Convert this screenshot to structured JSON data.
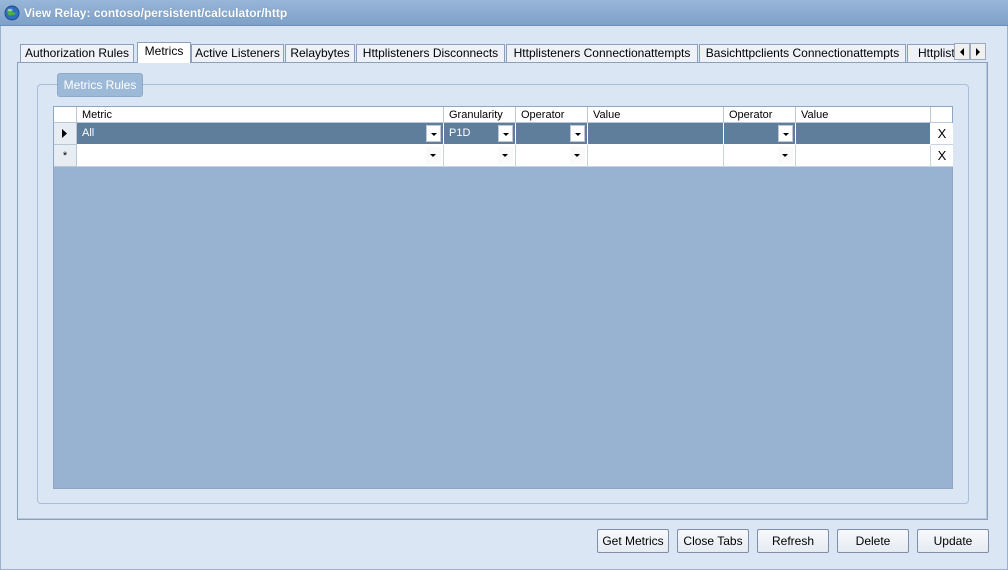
{
  "window": {
    "title": "View Relay: contoso/persistent/calculator/http",
    "icon": "globe-icon"
  },
  "tabs": [
    {
      "label": "Authorization Rules"
    },
    {
      "label": "Metrics"
    },
    {
      "label": "Active Listeners"
    },
    {
      "label": "Relaybytes"
    },
    {
      "label": "Httplisteners Disconnects"
    },
    {
      "label": "Httplisteners Connectionattempts"
    },
    {
      "label": "Basichttpclients Connectionattempts"
    },
    {
      "label": "Httplist"
    }
  ],
  "active_tab": "Metrics",
  "metrics": {
    "group_title": "Metrics Rules",
    "columns": [
      "Metric",
      "Granularity",
      "Operator",
      "Value",
      "Operator",
      "Value"
    ],
    "rows": [
      {
        "metric": "All",
        "granularity": "P1D",
        "operator1": "",
        "value1": "",
        "operator2": "",
        "value2": ""
      }
    ],
    "new_row_marker": "*",
    "delete_glyph": "X"
  },
  "buttons": {
    "get_metrics": "Get Metrics",
    "close_tabs": "Close Tabs",
    "refresh": "Refresh",
    "delete": "Delete",
    "update": "Update"
  },
  "colors": {
    "grid_background": "#98b3d1",
    "selected_row": "#5e7e9c",
    "window_background": "#dbe6f4"
  }
}
